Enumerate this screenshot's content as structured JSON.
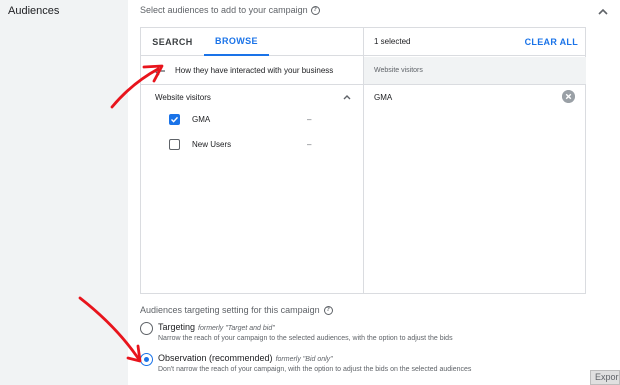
{
  "section": {
    "label": "Audiences"
  },
  "prompt": {
    "text": "Select audiences to add to your campaign",
    "help_icon": "help-circle-icon"
  },
  "browser": {
    "tabs": [
      {
        "label": "SEARCH",
        "active": false
      },
      {
        "label": "BROWSE",
        "active": true
      }
    ],
    "back_label": "How they have interacted with your business",
    "group_label": "Website visitors",
    "items": [
      {
        "label": "GMA",
        "checked": true,
        "value": "–"
      },
      {
        "label": "New Users",
        "checked": false,
        "value": "–"
      }
    ]
  },
  "selected": {
    "count_label": "1 selected",
    "clear_all_label": "CLEAR ALL",
    "group_label": "Website visitors",
    "items": [
      {
        "label": "GMA"
      }
    ]
  },
  "targeting_setting": {
    "title": "Audiences targeting setting for this campaign",
    "options": [
      {
        "name": "Targeting",
        "formerly": "formerly \"Target and bid\"",
        "description": "Narrow the reach of your campaign to the selected audiences, with the option to adjust the bids",
        "selected": false
      },
      {
        "name": "Observation (recommended)",
        "formerly": "formerly \"Bid only\"",
        "description": "Don't narrow the reach of your campaign, with the option to adjust the bids on the selected audiences",
        "selected": true
      }
    ]
  },
  "export_button": {
    "label": "Expor"
  },
  "colors": {
    "accent": "#1a73e8",
    "annotation": "#e8141c",
    "sidebar_bg": "#f1f3f4",
    "border": "#dadce0"
  }
}
